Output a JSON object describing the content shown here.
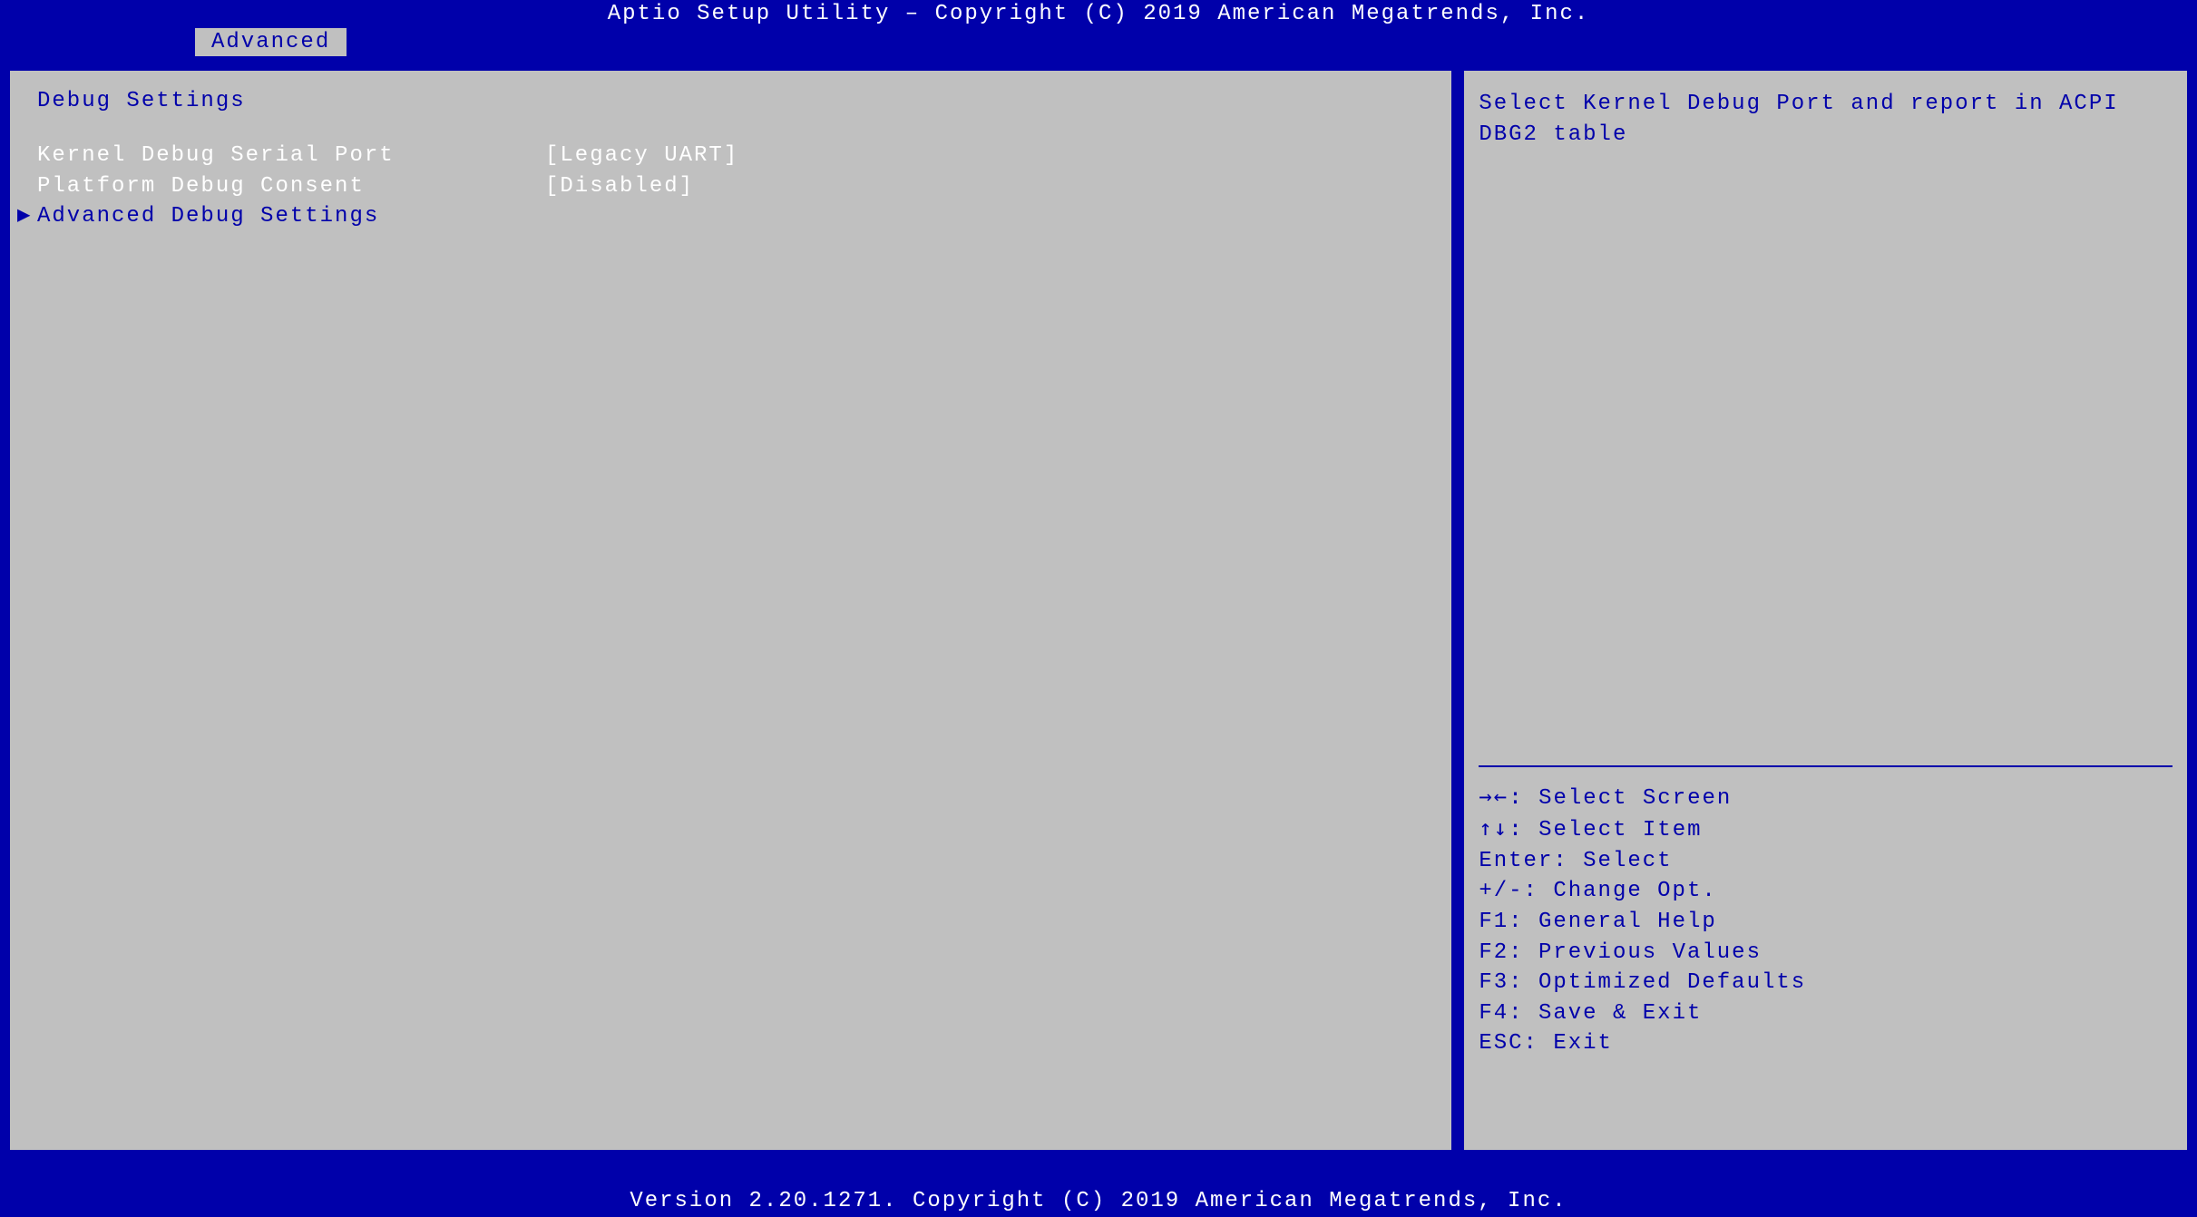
{
  "title": "Aptio Setup Utility – Copyright (C) 2019 American Megatrends, Inc.",
  "tab": {
    "label": "Advanced"
  },
  "main": {
    "section_title": "Debug Settings",
    "settings": [
      {
        "label": "Kernel Debug Serial Port",
        "value": "[Legacy UART]"
      },
      {
        "label": "Platform Debug Consent",
        "value": "[Disabled]"
      }
    ],
    "submenu": {
      "arrow": "▶",
      "label": "Advanced Debug Settings"
    }
  },
  "help": {
    "description": "Select Kernel Debug Port and report in ACPI DBG2 table",
    "keys": [
      {
        "sym": "→←:",
        "desc": " Select Screen"
      },
      {
        "sym": "↑↓:",
        "desc": " Select Item"
      },
      {
        "sym": "Enter:",
        "desc": " Select"
      },
      {
        "sym": "+/-:",
        "desc": " Change Opt."
      },
      {
        "sym": "F1:",
        "desc": " General Help"
      },
      {
        "sym": "F2:",
        "desc": " Previous Values"
      },
      {
        "sym": "F3:",
        "desc": " Optimized Defaults"
      },
      {
        "sym": "F4:",
        "desc": " Save & Exit"
      },
      {
        "sym": "ESC:",
        "desc": " Exit"
      }
    ]
  },
  "footer": "Version 2.20.1271. Copyright (C) 2019 American Megatrends, Inc."
}
